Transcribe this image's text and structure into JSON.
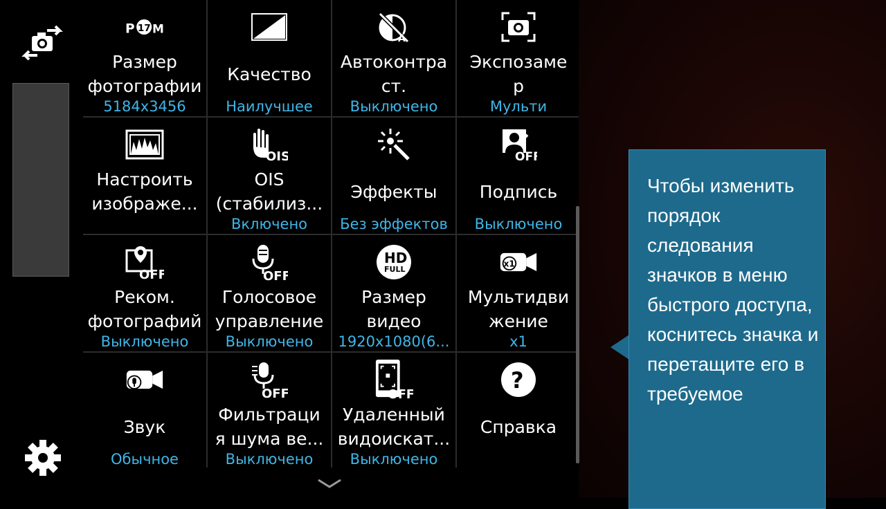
{
  "accent_color": "#3fb6e8",
  "tooltip_color": "#1e6a8c",
  "left_rail": {
    "switch_camera_icon": "camera-switch-icon",
    "settings_icon": "gear-icon"
  },
  "grid": [
    {
      "label": "Размер\nфотографии",
      "value": "5184x3456",
      "icon": "photo-size-icon",
      "icon_text": "17.9M"
    },
    {
      "label": "Качество",
      "value": "Наилучшее",
      "icon": "quality-icon"
    },
    {
      "label": "Автоконтра\nст.",
      "value": "Выключено",
      "icon": "auto-contrast-icon"
    },
    {
      "label": "Экспозаме\nр",
      "value": "Мульти",
      "icon": "metering-icon"
    },
    {
      "label": "Настроить\nизображе...",
      "value": "",
      "icon": "adjust-image-icon"
    },
    {
      "label": "OIS\n(стабилиз...",
      "value": "Включено",
      "icon": "ois-icon",
      "icon_text": "OIS"
    },
    {
      "label": "Эффекты",
      "value": "Без эффектов",
      "icon": "effects-icon"
    },
    {
      "label": "Подпись",
      "value": "Выключено",
      "icon": "signature-icon",
      "icon_text": "OFF"
    },
    {
      "label": "Реком.\nфотографий",
      "value": "Выключено",
      "icon": "photo-recommend-icon",
      "icon_text": "OFF"
    },
    {
      "label": "Голосовое\nуправление",
      "value": "Выключено",
      "icon": "voice-control-icon",
      "icon_text": "OFF"
    },
    {
      "label": "Размер\nвидео",
      "value": "1920x1080(6...",
      "icon": "video-size-icon",
      "icon_text": "HD FULL"
    },
    {
      "label": "Мультидви\nжение",
      "value": "x1",
      "icon": "multi-motion-icon",
      "icon_text": "x1"
    },
    {
      "label": "Звук",
      "value": "Обычное",
      "icon": "audio-icon"
    },
    {
      "label": "Фильтраци\nя шума ве...",
      "value": "Выключено",
      "icon": "wind-filter-icon",
      "icon_text": "OFF"
    },
    {
      "label": "Удаленный\nвидоискат...",
      "value": "Выключено",
      "icon": "remote-viewfinder-icon",
      "icon_text": "OFF"
    },
    {
      "label": "Справка",
      "value": "",
      "icon": "help-icon",
      "icon_text": "?"
    }
  ],
  "tooltip": {
    "text": "Чтобы изменить порядок следования значков в меню быстрого доступа, коснитесь значка и перетащите его в требуемое"
  },
  "scroll_hint_icon": "chevron-down-icon"
}
